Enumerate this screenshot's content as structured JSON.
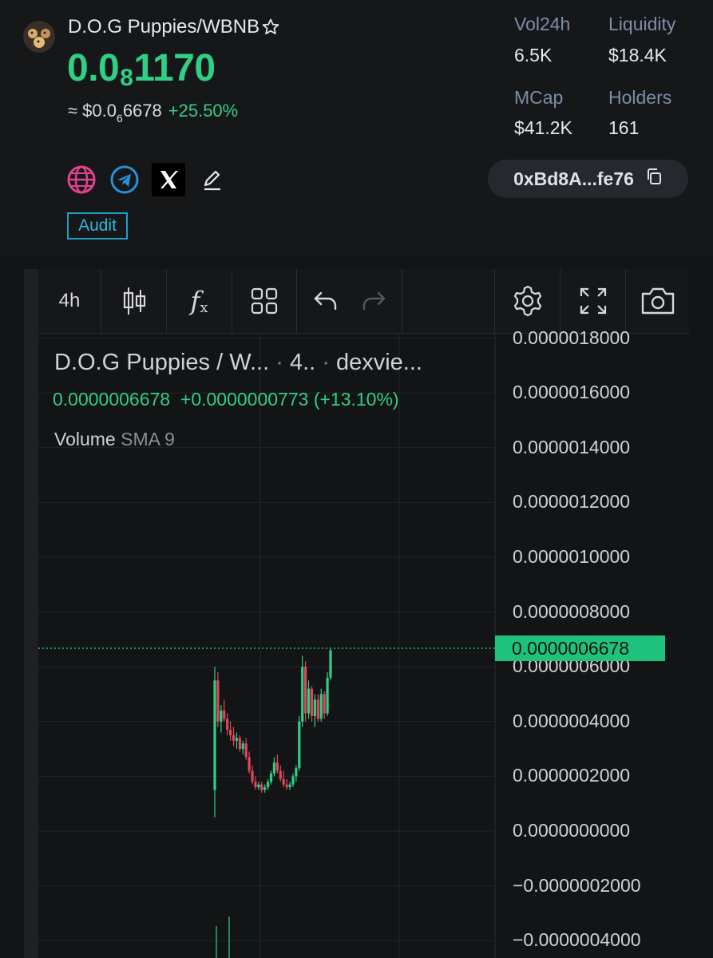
{
  "token": {
    "pair": "D.O.G Puppies/WBNB",
    "price_lead": "0.0",
    "price_sub": "8",
    "price_tail": "1170",
    "usd_approx": "≈ $0.0",
    "usd_sub": "6",
    "usd_tail": "6678",
    "change_pct": "+25.50%"
  },
  "stats": {
    "vol24h_label": "Vol24h",
    "vol24h_value": "6.5K",
    "liquidity_label": "Liquidity",
    "liquidity_value": "$18.4K",
    "mcap_label": "MCap",
    "mcap_value": "$41.2K",
    "holders_label": "Holders",
    "holders_value": "161"
  },
  "links": {
    "website_icon": "globe-icon",
    "telegram_icon": "telegram-icon",
    "x_icon": "x-logo-icon",
    "edit_icon": "pencil-icon",
    "audit_label": "Audit",
    "address_short": "0xBd8A...fe76",
    "copy_icon": "copy-icon"
  },
  "toolbar": {
    "interval_label": "4h",
    "candle_icon": "candlestick-icon",
    "indicators_icon": "fx-icon",
    "layout_icon": "grid-icon",
    "undo_icon": "undo-icon",
    "redo_icon": "redo-icon",
    "settings_icon": "gear-icon",
    "fullscreen_icon": "expand-icon",
    "snapshot_icon": "camera-icon"
  },
  "chart_legend": {
    "title": "D.O.G Puppies / W...",
    "interval": "4..",
    "source": "dexvie...",
    "last_price": "0.0000006678",
    "abs_change": "+0.0000000773",
    "pct_change": "(+13.10%)",
    "volume_label": "Volume",
    "volume_sma": "SMA 9"
  },
  "colors": {
    "up": "#2fcf86",
    "down": "#e0475a",
    "background": "#131416",
    "accent_link": "#1f9fc6"
  },
  "chart_data": {
    "type": "candlestick",
    "y_axis_ticks": [
      "0.0000018000",
      "0.0000016000",
      "0.0000014000",
      "0.0000012000",
      "0.0000010000",
      "0.0000008000",
      "0.0000006000",
      "0.0000004000",
      "0.0000002000",
      "0.0000000000",
      "−0.0000002000",
      "−0.0000004000"
    ],
    "ylim": [
      -4e-07,
      1.8e-06
    ],
    "current_price": 6.678e-07,
    "current_price_label": "0.0000006678",
    "candles": [
      {
        "o": 1.5e-07,
        "h": 6e-07,
        "l": 5e-08,
        "c": 5.5e-07
      },
      {
        "o": 5.5e-07,
        "h": 5.8e-07,
        "l": 3.8e-07,
        "c": 4e-07
      },
      {
        "o": 4e-07,
        "h": 4.6e-07,
        "l": 3.6e-07,
        "c": 4.4e-07
      },
      {
        "o": 4.4e-07,
        "h": 4.8e-07,
        "l": 4e-07,
        "c": 4.1e-07
      },
      {
        "o": 4.1e-07,
        "h": 4.3e-07,
        "l": 3.5e-07,
        "c": 3.7e-07
      },
      {
        "o": 3.7e-07,
        "h": 4e-07,
        "l": 3.3e-07,
        "c": 3.5e-07
      },
      {
        "o": 3.5e-07,
        "h": 3.8e-07,
        "l": 3.1e-07,
        "c": 3.3e-07
      },
      {
        "o": 3.3e-07,
        "h": 3.6e-07,
        "l": 3e-07,
        "c": 3.4e-07
      },
      {
        "o": 3.4e-07,
        "h": 3.5e-07,
        "l": 2.9e-07,
        "c": 3e-07
      },
      {
        "o": 3e-07,
        "h": 3.3e-07,
        "l": 2.8e-07,
        "c": 3.2e-07
      },
      {
        "o": 3.2e-07,
        "h": 3.4e-07,
        "l": 2.6e-07,
        "c": 2.7e-07
      },
      {
        "o": 2.7e-07,
        "h": 2.9e-07,
        "l": 2.1e-07,
        "c": 2.2e-07
      },
      {
        "o": 2.2e-07,
        "h": 2.4e-07,
        "l": 1.7e-07,
        "c": 1.8e-07
      },
      {
        "o": 1.8e-07,
        "h": 2e-07,
        "l": 1.5e-07,
        "c": 1.6e-07
      },
      {
        "o": 1.6e-07,
        "h": 1.8e-07,
        "l": 1.5e-07,
        "c": 1.7e-07
      },
      {
        "o": 1.7e-07,
        "h": 1.8e-07,
        "l": 1.4e-07,
        "c": 1.5e-07
      },
      {
        "o": 1.5e-07,
        "h": 1.7e-07,
        "l": 1.4e-07,
        "c": 1.6e-07
      },
      {
        "o": 1.6e-07,
        "h": 1.9e-07,
        "l": 1.5e-07,
        "c": 1.8e-07
      },
      {
        "o": 1.8e-07,
        "h": 2.2e-07,
        "l": 1.7e-07,
        "c": 2.1e-07
      },
      {
        "o": 2.1e-07,
        "h": 2.7e-07,
        "l": 2e-07,
        "c": 2.5e-07
      },
      {
        "o": 2.5e-07,
        "h": 2.8e-07,
        "l": 2.1e-07,
        "c": 2.2e-07
      },
      {
        "o": 2.2e-07,
        "h": 2.4e-07,
        "l": 1.8e-07,
        "c": 1.9e-07
      },
      {
        "o": 1.9e-07,
        "h": 2.2e-07,
        "l": 1.6e-07,
        "c": 1.7e-07
      },
      {
        "o": 1.7e-07,
        "h": 1.9e-07,
        "l": 1.5e-07,
        "c": 1.6e-07
      },
      {
        "o": 1.6e-07,
        "h": 1.8e-07,
        "l": 1.5e-07,
        "c": 1.7e-07
      },
      {
        "o": 1.7e-07,
        "h": 2.1e-07,
        "l": 1.6e-07,
        "c": 2e-07
      },
      {
        "o": 2e-07,
        "h": 2.4e-07,
        "l": 1.8e-07,
        "c": 2.3e-07
      },
      {
        "o": 2.3e-07,
        "h": 4.2e-07,
        "l": 2.2e-07,
        "c": 4e-07
      },
      {
        "o": 4e-07,
        "h": 6.4e-07,
        "l": 3.8e-07,
        "c": 6e-07
      },
      {
        "o": 6e-07,
        "h": 6.2e-07,
        "l": 4e-07,
        "c": 4.3e-07
      },
      {
        "o": 4.3e-07,
        "h": 5.5e-07,
        "l": 4.1e-07,
        "c": 5.2e-07
      },
      {
        "o": 5.2e-07,
        "h": 5.3e-07,
        "l": 4e-07,
        "c": 4.2e-07
      },
      {
        "o": 4.2e-07,
        "h": 5e-07,
        "l": 3.8e-07,
        "c": 4.8e-07
      },
      {
        "o": 4.8e-07,
        "h": 5e-07,
        "l": 4e-07,
        "c": 4.1e-07
      },
      {
        "o": 4.1e-07,
        "h": 5.2e-07,
        "l": 4e-07,
        "c": 5e-07
      },
      {
        "o": 5e-07,
        "h": 5.1e-07,
        "l": 4.1e-07,
        "c": 4.3e-07
      },
      {
        "o": 4.3e-07,
        "h": 5.8e-07,
        "l": 4.2e-07,
        "c": 5.6e-07
      },
      {
        "o": 5.6e-07,
        "h": 6.7e-07,
        "l": 5.5e-07,
        "c": 6.6e-07
      }
    ]
  }
}
